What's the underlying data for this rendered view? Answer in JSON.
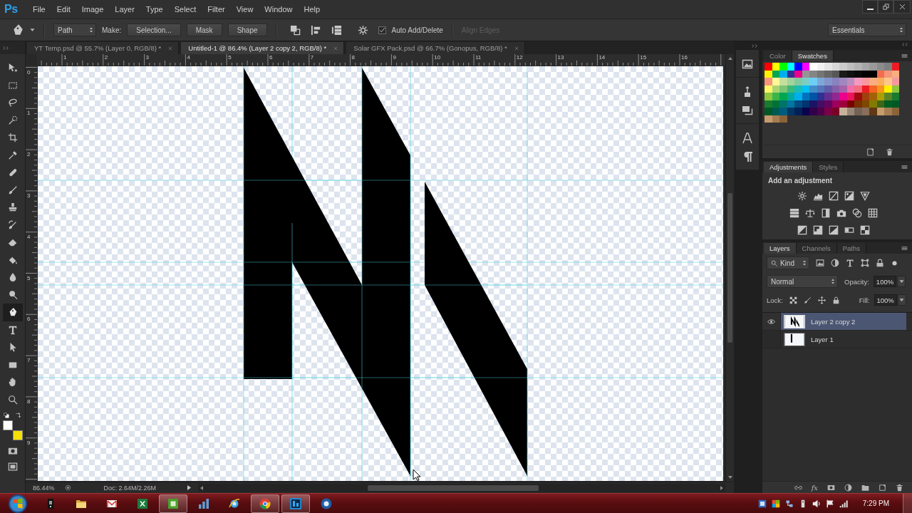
{
  "app": {
    "logo": "Ps"
  },
  "menu": [
    "File",
    "Edit",
    "Image",
    "Layer",
    "Type",
    "Select",
    "Filter",
    "View",
    "Window",
    "Help"
  ],
  "options_bar": {
    "mode": "Path",
    "make_label": "Make:",
    "make_buttons": [
      "Selection...",
      "Mask",
      "Shape"
    ],
    "auto_add_delete": {
      "label": "Auto Add/Delete",
      "checked": true
    },
    "align_edges": {
      "label": "Align Edges",
      "disabled": true
    },
    "workspace": "Essentials"
  },
  "document_tabs": [
    {
      "title": "YT Temp.psd @ 55.7% (Layer 0, RGB/8) *",
      "selected": false
    },
    {
      "title": "Untitled-1 @ 86.4% (Layer 2 copy 2, RGB/8) *",
      "selected": true
    },
    {
      "title": "Solar GFX Pack.psd @ 66.7% (Gonopus, RGB/8) *",
      "selected": false
    }
  ],
  "rulers": {
    "horizontal": [
      "1",
      "2",
      "3",
      "4",
      "5",
      "6",
      "7",
      "8",
      "9",
      "10",
      "11",
      "12",
      "13",
      "14",
      "15",
      "16"
    ],
    "vertical": [
      "0",
      "1",
      "2",
      "3",
      "4",
      "5",
      "6",
      "7",
      "8",
      "9"
    ]
  },
  "tools": [
    {
      "kind": "move",
      "selected": false
    },
    {
      "kind": "marquee",
      "selected": false
    },
    {
      "kind": "lasso",
      "selected": false
    },
    {
      "kind": "quick_select",
      "selected": false
    },
    {
      "kind": "crop",
      "selected": false
    },
    {
      "kind": "eyedropper",
      "selected": false
    },
    {
      "kind": "healing",
      "selected": false
    },
    {
      "kind": "brush",
      "selected": false
    },
    {
      "kind": "stamp",
      "selected": false
    },
    {
      "kind": "history_brush",
      "selected": false
    },
    {
      "kind": "eraser",
      "selected": false
    },
    {
      "kind": "bucket",
      "selected": false
    },
    {
      "kind": "blur",
      "selected": false
    },
    {
      "kind": "dodge",
      "selected": false
    },
    {
      "kind": "pen",
      "selected": true
    },
    {
      "kind": "type",
      "selected": false
    },
    {
      "kind": "path_select",
      "selected": false
    },
    {
      "kind": "rectangle",
      "selected": false
    },
    {
      "kind": "hand",
      "selected": false
    },
    {
      "kind": "zoom",
      "selected": false
    }
  ],
  "color_chips": [
    {
      "kind": "foreground",
      "color": "#ffffff"
    },
    {
      "kind": "background",
      "color": "#f5e100"
    }
  ],
  "status_bar": {
    "zoom": "86.44%",
    "doc_size": "Doc: 2.64M/2.26M"
  },
  "panels": {
    "swatches_panel": {
      "tabs": [
        {
          "label": "Color",
          "selected": false
        },
        {
          "label": "Swatches",
          "selected": true
        }
      ],
      "swatches": [
        {
          "color": "#ff0000"
        },
        {
          "color": "#ffff00"
        },
        {
          "color": "#00ff00"
        },
        {
          "color": "#00ffff"
        },
        {
          "color": "#0000ff"
        },
        {
          "color": "#ff00ff"
        },
        {
          "color": "#ffffff"
        },
        {
          "color": "#f2f2f2"
        },
        {
          "color": "#e6e6e6"
        },
        {
          "color": "#d9d9d9"
        },
        {
          "color": "#cccccc"
        },
        {
          "color": "#bfbfbf"
        },
        {
          "color": "#b3b3b3"
        },
        {
          "color": "#a6a6a6"
        },
        {
          "color": "#999999"
        },
        {
          "color": "#8c8c8c"
        },
        {
          "color": "#808080"
        },
        {
          "color": "#ed1c24"
        },
        {
          "color": "#fff200"
        },
        {
          "color": "#00a651"
        },
        {
          "color": "#00aeef"
        },
        {
          "color": "#2e3192"
        },
        {
          "color": "#ec008c"
        },
        {
          "color": "#959595"
        },
        {
          "color": "#858585"
        },
        {
          "color": "#757575"
        },
        {
          "color": "#666666"
        },
        {
          "color": "#575757"
        },
        {
          "color": "#1a1a1a"
        },
        {
          "color": "#111111"
        },
        {
          "color": "#0a0a0a"
        },
        {
          "color": "#000000"
        },
        {
          "color": "#000000"
        },
        {
          "color": "#f26c4f"
        },
        {
          "color": "#f69679"
        },
        {
          "color": "#f9ad81"
        },
        {
          "color": "#f7977a"
        },
        {
          "color": "#fff799"
        },
        {
          "color": "#c4df9b"
        },
        {
          "color": "#a3d39c"
        },
        {
          "color": "#82ca9d"
        },
        {
          "color": "#7bcdc8"
        },
        {
          "color": "#6ecff6"
        },
        {
          "color": "#7ea7d8"
        },
        {
          "color": "#8493ca"
        },
        {
          "color": "#8882be"
        },
        {
          "color": "#a187be"
        },
        {
          "color": "#bc8dbf"
        },
        {
          "color": "#f49ac2"
        },
        {
          "color": "#f6989d"
        },
        {
          "color": "#f9ad81"
        },
        {
          "color": "#fbaf5d"
        },
        {
          "color": "#fdc68a"
        },
        {
          "color": "#f5989d"
        },
        {
          "color": "#fff568"
        },
        {
          "color": "#acd373"
        },
        {
          "color": "#7cc576"
        },
        {
          "color": "#3bb878"
        },
        {
          "color": "#1abbb4"
        },
        {
          "color": "#00bff3"
        },
        {
          "color": "#438cca"
        },
        {
          "color": "#5574b9"
        },
        {
          "color": "#605ca8"
        },
        {
          "color": "#855fa8"
        },
        {
          "color": "#a763a8"
        },
        {
          "color": "#f06eaa"
        },
        {
          "color": "#f26d7d"
        },
        {
          "color": "#ed1c24"
        },
        {
          "color": "#f26522"
        },
        {
          "color": "#f7941d"
        },
        {
          "color": "#fff200"
        },
        {
          "color": "#8dc63f"
        },
        {
          "color": "#8dc63f"
        },
        {
          "color": "#39b54a"
        },
        {
          "color": "#00a651"
        },
        {
          "color": "#00a99d"
        },
        {
          "color": "#00aeef"
        },
        {
          "color": "#0072bc"
        },
        {
          "color": "#0054a6"
        },
        {
          "color": "#2e3192"
        },
        {
          "color": "#662d91"
        },
        {
          "color": "#92278f"
        },
        {
          "color": "#ec008c"
        },
        {
          "color": "#ed145b"
        },
        {
          "color": "#9e0b0f"
        },
        {
          "color": "#a0410d"
        },
        {
          "color": "#a36209"
        },
        {
          "color": "#aba000"
        },
        {
          "color": "#598527"
        },
        {
          "color": "#1a7b30"
        },
        {
          "color": "#197b30"
        },
        {
          "color": "#007236"
        },
        {
          "color": "#00746b"
        },
        {
          "color": "#0076a3"
        },
        {
          "color": "#004b80"
        },
        {
          "color": "#003471"
        },
        {
          "color": "#1b1464"
        },
        {
          "color": "#440e62"
        },
        {
          "color": "#630460"
        },
        {
          "color": "#9e005d"
        },
        {
          "color": "#9e0039"
        },
        {
          "color": "#790000"
        },
        {
          "color": "#7b2e00"
        },
        {
          "color": "#7d4900"
        },
        {
          "color": "#827b00"
        },
        {
          "color": "#406618"
        },
        {
          "color": "#005e20"
        },
        {
          "color": "#005826"
        },
        {
          "color": "#005826"
        },
        {
          "color": "#005952"
        },
        {
          "color": "#005b7f"
        },
        {
          "color": "#003663"
        },
        {
          "color": "#002157"
        },
        {
          "color": "#0d004c"
        },
        {
          "color": "#32004b"
        },
        {
          "color": "#4b0049"
        },
        {
          "color": "#7b0046"
        },
        {
          "color": "#7a0026"
        },
        {
          "color": "#c7b299"
        },
        {
          "color": "#998675"
        },
        {
          "color": "#736357"
        },
        {
          "color": "#8a6e5c"
        },
        {
          "color": "#603913"
        },
        {
          "color": "#c69c6d"
        },
        {
          "color": "#a67c52"
        },
        {
          "color": "#8c6239"
        },
        {
          "color": "#c69c6d"
        },
        {
          "color": "#a67c52"
        },
        {
          "color": "#8c6239"
        }
      ]
    },
    "adjustments_panel": {
      "tabs": [
        {
          "label": "Adjustments",
          "selected": true
        },
        {
          "label": "Styles",
          "selected": false
        }
      ],
      "hint": "Add an adjustment"
    },
    "layers_panel": {
      "tabs": [
        {
          "label": "Layers",
          "selected": true
        },
        {
          "label": "Channels",
          "selected": false
        },
        {
          "label": "Paths",
          "selected": false
        }
      ],
      "filter": "Kind",
      "blend_mode": "Normal",
      "opacity_label": "Opacity:",
      "opacity": "100%",
      "lock_label": "Lock:",
      "fill_label": "Fill:",
      "fill": "100%",
      "layers": [
        {
          "name": "Layer 2 copy 2",
          "visible": true,
          "selected": true
        },
        {
          "name": "Layer 1",
          "visible": false,
          "selected": false
        }
      ],
      "effects_label": "fx"
    }
  },
  "taskbar": {
    "apps": [
      {
        "kind": "device",
        "running": false
      },
      {
        "kind": "folder",
        "running": false
      },
      {
        "kind": "mail",
        "running": false
      },
      {
        "kind": "spreadsheet",
        "running": false
      },
      {
        "kind": "green_app",
        "running": true
      },
      {
        "kind": "chart",
        "running": false
      },
      {
        "kind": "browser_e",
        "running": false
      },
      {
        "kind": "chrome",
        "running": true
      },
      {
        "kind": "photoshop",
        "running": true
      },
      {
        "kind": "disc",
        "running": false
      }
    ],
    "clock": "7:29 PM"
  }
}
